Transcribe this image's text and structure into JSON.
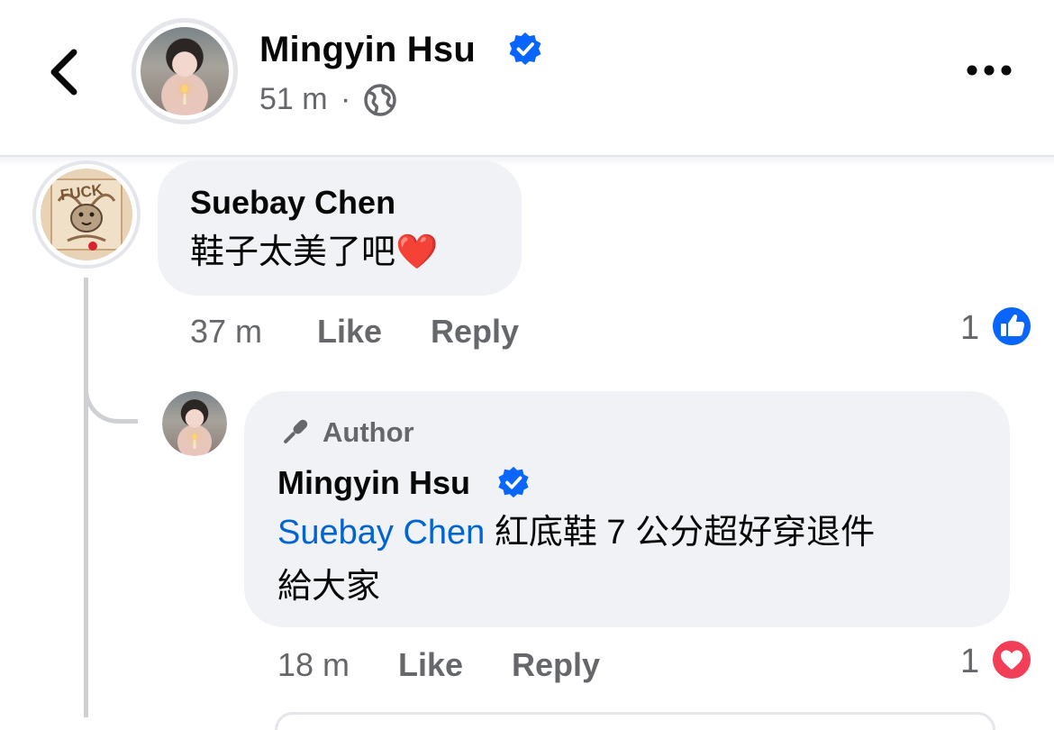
{
  "post_header": {
    "back_label": "‹",
    "author_name": "Mingyin Hsu",
    "time": "51 m",
    "separator": "·",
    "more_label": "•••",
    "icons": {
      "back": "chevron-left-icon",
      "verified": "verified-badge-icon",
      "audience": "globe-icon",
      "more": "more-horizontal-icon"
    }
  },
  "comments": [
    {
      "author": "Suebay Chen",
      "text": "鞋子太美了吧❤️",
      "time": "37 m",
      "like_label": "Like",
      "reply_label": "Reply",
      "reaction_count": "1",
      "reaction_icon": "like-reaction-icon",
      "avatar_text": "FUCK"
    },
    {
      "badge_label": "Author",
      "badge_icon": "microphone-icon",
      "author": "Mingyin Hsu",
      "mention": "Suebay Chen",
      "text_line1": "紅底鞋 7 公分超好穿退件",
      "text_line2": "給大家",
      "time": "18 m",
      "like_label": "Like",
      "reply_label": "Reply",
      "reaction_count": "1",
      "reaction_icon": "love-reaction-icon"
    }
  ],
  "colors": {
    "facebook_blue": "#0866ff",
    "mention_blue": "#0064d1",
    "bubble_gray": "#f0f2f5",
    "secondary_text": "#65676b",
    "love_red": "#f33e58"
  }
}
